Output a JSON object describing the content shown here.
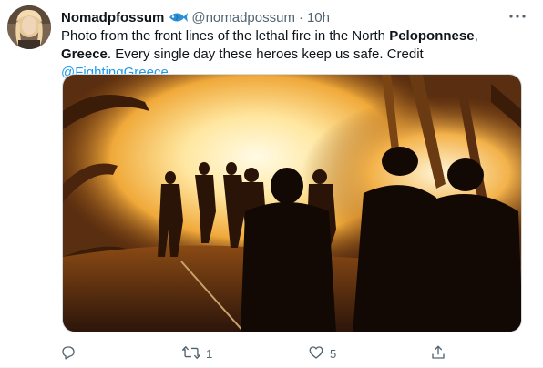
{
  "tweet": {
    "display_name": "Nomadpfossum",
    "handle": "@nomadpossum",
    "separator": "·",
    "time": "10h",
    "text_parts": {
      "p1": "Photo from the front lines of the lethal fire in the North ",
      "bold1": "Peloponnese",
      "p2": ",",
      "bold2": "Greece",
      "p3": ". Every single day these heroes keep us safe. Credit ",
      "mention": "@FightingGreece"
    },
    "stats": {
      "replies": "",
      "retweets": "1",
      "likes": "5"
    }
  },
  "icons": {
    "badge": "fish-icon",
    "more": "more-dots-icon",
    "reply": "reply-icon",
    "retweet": "retweet-icon",
    "like": "heart-icon",
    "share": "share-icon"
  },
  "colors": {
    "link": "#1d9bf0",
    "muted": "#536471",
    "text": "#0f1419",
    "badge": "#2b8fd6"
  }
}
